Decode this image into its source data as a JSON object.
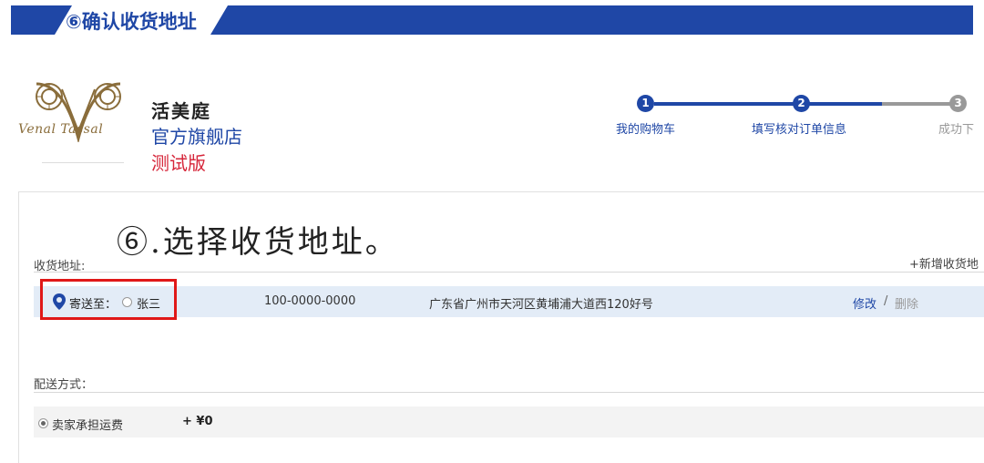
{
  "banner": {
    "title": "⑥确认收货地址"
  },
  "store": {
    "logo_script": "Venal  Tassal",
    "name": "活美庭",
    "subtitle": "官方旗舰店",
    "test_label": "测试版"
  },
  "progress": {
    "steps": [
      {
        "number": "1",
        "label": "我的购物车"
      },
      {
        "number": "2",
        "label": "填写核对订单信息"
      },
      {
        "number": "3",
        "label": "成功下"
      }
    ],
    "current_step": 2,
    "colors": {
      "active": "#1f47a6",
      "inactive": "#999999"
    }
  },
  "annotation": {
    "text": "⑥.选择收货地址。"
  },
  "address_section": {
    "label": "收货地址:",
    "add_link": "+新增收货地",
    "selected": {
      "send_to_label": "寄送至：",
      "name": "张三",
      "phone": "100-0000-0000",
      "address": "广东省广州市天河区黄埔浦大道西120好号",
      "edit_label": "修改",
      "separator": "/",
      "delete_label": "删除"
    }
  },
  "shipping_section": {
    "label": "配送方式：",
    "option": {
      "label": "卖家承担运费",
      "price": "+ ¥0"
    }
  },
  "colors": {
    "brand_blue": "#1f47a6",
    "highlight_red": "#e01818",
    "test_red": "#d6263a"
  }
}
